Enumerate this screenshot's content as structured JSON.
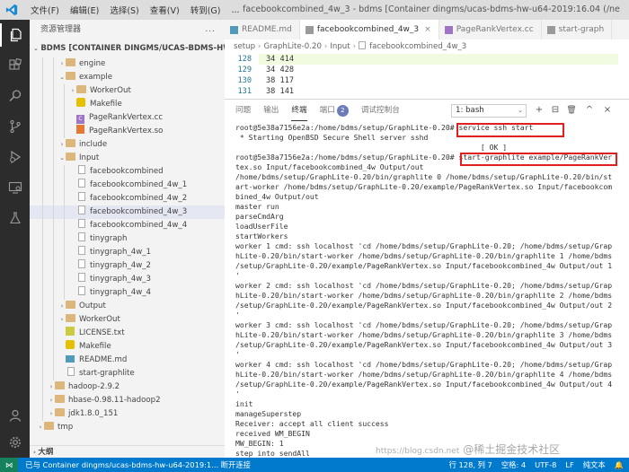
{
  "titlebar": {
    "menu": [
      "文件(F)",
      "编辑(E)",
      "选择(S)",
      "查看(V)",
      "转到(G)",
      "..."
    ],
    "title": "facebookcombined_4w_3 - bdms [Container dingms/ucas-bdms-hw-u64-2019:16.04 (/ner..."
  },
  "sidebar": {
    "title": "资源管理器",
    "more": "...",
    "folder": "BDMS [CONTAINER DINGMS/UCAS-BDMS-HW-U64-20...",
    "outline": "大纲",
    "items": [
      {
        "label": "engine",
        "depth": 2,
        "kind": "folder",
        "chev": "›"
      },
      {
        "label": "example",
        "depth": 2,
        "kind": "folder",
        "chev": "⌄"
      },
      {
        "label": "WorkerOut",
        "depth": 3,
        "kind": "folder",
        "chev": "›"
      },
      {
        "label": "Makefile",
        "depth": 3,
        "kind": "make",
        "chev": ""
      },
      {
        "label": "PageRankVertex.cc",
        "depth": 3,
        "kind": "cpp",
        "chev": ""
      },
      {
        "label": "PageRankVertex.so",
        "depth": 3,
        "kind": "red",
        "chev": ""
      },
      {
        "label": "include",
        "depth": 2,
        "kind": "folder",
        "chev": "›"
      },
      {
        "label": "Input",
        "depth": 2,
        "kind": "folder",
        "chev": "⌄"
      },
      {
        "label": "facebookcombined",
        "depth": 3,
        "kind": "file",
        "chev": ""
      },
      {
        "label": "facebookcombined_4w_1",
        "depth": 3,
        "kind": "file",
        "chev": ""
      },
      {
        "label": "facebookcombined_4w_2",
        "depth": 3,
        "kind": "file",
        "chev": ""
      },
      {
        "label": "facebookcombined_4w_3",
        "depth": 3,
        "kind": "file",
        "chev": "",
        "selected": true
      },
      {
        "label": "facebookcombined_4w_4",
        "depth": 3,
        "kind": "file",
        "chev": ""
      },
      {
        "label": "tinygraph",
        "depth": 3,
        "kind": "file",
        "chev": ""
      },
      {
        "label": "tinygraph_4w_1",
        "depth": 3,
        "kind": "file",
        "chev": ""
      },
      {
        "label": "tinygraph_4w_2",
        "depth": 3,
        "kind": "file",
        "chev": ""
      },
      {
        "label": "tinygraph_4w_3",
        "depth": 3,
        "kind": "file",
        "chev": ""
      },
      {
        "label": "tinygraph_4w_4",
        "depth": 3,
        "kind": "file",
        "chev": ""
      },
      {
        "label": "Output",
        "depth": 2,
        "kind": "folder",
        "chev": "›"
      },
      {
        "label": "WorkerOut",
        "depth": 2,
        "kind": "folder",
        "chev": "›"
      },
      {
        "label": "LICENSE.txt",
        "depth": 2,
        "kind": "lic",
        "chev": ""
      },
      {
        "label": "Makefile",
        "depth": 2,
        "kind": "make",
        "chev": ""
      },
      {
        "label": "README.md",
        "depth": 2,
        "kind": "md",
        "chev": ""
      },
      {
        "label": "start-graphlite",
        "depth": 2,
        "kind": "file",
        "chev": ""
      },
      {
        "label": "hadoop-2.9.2",
        "depth": 1,
        "kind": "folder",
        "chev": "›"
      },
      {
        "label": "hbase-0.98.11-hadoop2",
        "depth": 1,
        "kind": "folder",
        "chev": "›"
      },
      {
        "label": "jdk1.8.0_151",
        "depth": 1,
        "kind": "folder",
        "chev": "›"
      },
      {
        "label": "tmp",
        "depth": 0,
        "kind": "folder",
        "chev": "›"
      }
    ]
  },
  "tabs": [
    {
      "label": "README.md",
      "icon": "#519aba",
      "active": false,
      "close": ""
    },
    {
      "label": "facebookcombined_4w_3",
      "icon": "#9a9a9a",
      "active": true,
      "close": "×"
    },
    {
      "label": "PageRankVertex.cc",
      "icon": "#a074c4",
      "active": false,
      "close": ""
    },
    {
      "label": "start-graph",
      "icon": "#9a9a9a",
      "active": false,
      "close": ""
    }
  ],
  "breadcrumb": [
    "setup",
    "GraphLite-0.20",
    "Input",
    "facebookcombined_4w_3"
  ],
  "editor": {
    "lines": [
      {
        "n": "128",
        "code": "34 414",
        "current": true
      },
      {
        "n": "129",
        "code": "34 428",
        "current": false
      },
      {
        "n": "130",
        "code": "38 117",
        "current": false
      },
      {
        "n": "131",
        "code": "38 141",
        "current": false
      }
    ]
  },
  "panel": {
    "tabs": [
      "问题",
      "输出",
      "终端",
      "端口",
      "调试控制台"
    ],
    "active_tab": "终端",
    "ports_badge": "2",
    "terminal_select": "1: bash",
    "buttons": [
      "+",
      "⊟",
      "🗑",
      "^",
      "×"
    ],
    "terminal_lines": [
      "root@5e38a7156e2a:/home/bdms/setup/GraphLite-0.20# service ssh start",
      " * Starting OpenBSD Secure Shell server sshd",
      "                                                        [ OK ]",
      "root@5e38a7156e2a:/home/bdms/setup/GraphLite-0.20# start-graphlite example/PageRankVer",
      "tex.so Input/facebookcombined_4w Output/out",
      "/home/bdms/setup/GraphLite-0.20/bin/graphlite 0 /home/bdms/setup/GraphLite-0.20/bin/st",
      "art-worker /home/bdms/setup/GraphLite-0.20/example/PageRankVertex.so Input/facebookcom",
      "bined_4w Output/out",
      "master run",
      "parseCmdArg",
      "loadUserFile",
      "startWorkers",
      "worker 1 cmd: ssh localhost 'cd /home/bdms/setup/GraphLite-0.20; /home/bdms/setup/Grap",
      "hLite-0.20/bin/start-worker /home/bdms/setup/GraphLite-0.20/bin/graphlite 1 /home/bdms",
      "/setup/GraphLite-0.20/example/PageRankVertex.so Input/facebookcombined_4w Output/out 1",
      "'",
      "worker 2 cmd: ssh localhost 'cd /home/bdms/setup/GraphLite-0.20; /home/bdms/setup/Grap",
      "hLite-0.20/bin/start-worker /home/bdms/setup/GraphLite-0.20/bin/graphlite 2 /home/bdms",
      "/setup/GraphLite-0.20/example/PageRankVertex.so Input/facebookcombined_4w Output/out 2",
      "'",
      "worker 3 cmd: ssh localhost 'cd /home/bdms/setup/GraphLite-0.20; /home/bdms/setup/Grap",
      "hLite-0.20/bin/start-worker /home/bdms/setup/GraphLite-0.20/bin/graphlite 3 /home/bdms",
      "/setup/GraphLite-0.20/example/PageRankVertex.so Input/facebookcombined_4w Output/out 3",
      "'",
      "worker 4 cmd: ssh localhost 'cd /home/bdms/setup/GraphLite-0.20; /home/bdms/setup/Grap",
      "hLite-0.20/bin/start-worker /home/bdms/setup/GraphLite-0.20/bin/graphlite 4 /home/bdms",
      "/setup/GraphLite-0.20/example/PageRankVertex.so Input/facebookcombined_4w Output/out 4",
      "'",
      "init",
      "manageSuperstep",
      "Receiver: accept all client success",
      "received WM_BEGIN",
      "MW_BEGIN: 1",
      "step into sendAll"
    ]
  },
  "statusbar": {
    "remote": "⋈",
    "left": "已与 Container dingms/ucas-bdms-hw-u64-2019:1... 断开连接",
    "right": [
      "行 128, 列 7",
      "空格: 4",
      "UTF-8",
      "LF",
      "纯文本",
      "🔔"
    ]
  },
  "watermark": {
    "url": "https://blog.csdn.net",
    "brand": "@稀土掘金技术社区"
  },
  "colors": {
    "accent": "#007acc",
    "highlight": "#e0201e",
    "activitybar": "#2c2c2c"
  },
  "icons": {
    "activity": [
      "explorer-icon",
      "extensions-icon",
      "search-icon",
      "source-control-icon",
      "debug-icon",
      "remote-explorer-icon",
      "testing-icon"
    ],
    "bottom": [
      "account-icon",
      "gear-icon"
    ]
  }
}
